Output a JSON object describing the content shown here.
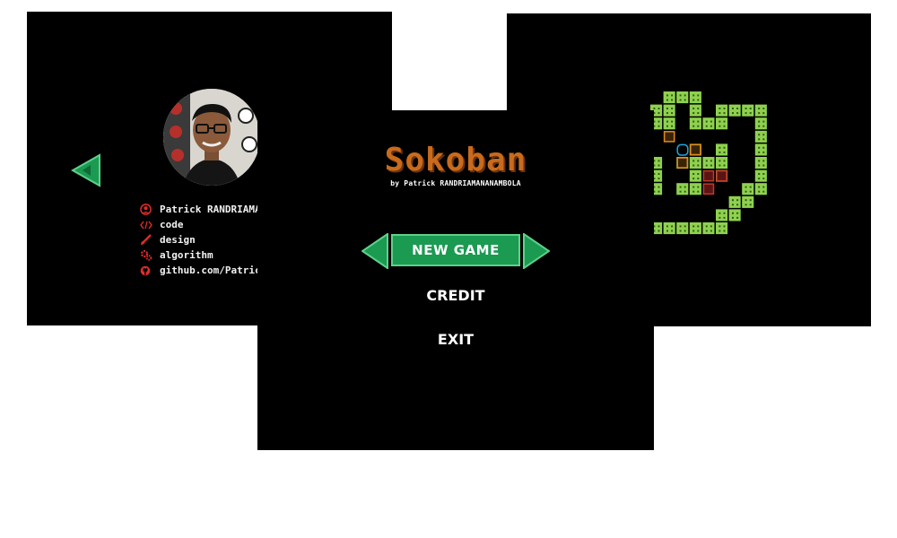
{
  "credit_screen": {
    "back_icon": "left-triangle-icon",
    "author_name": "Patrick RANDRIAMANA",
    "items": [
      {
        "icon": "user-circle-icon",
        "label": "Patrick RANDRIAMANA"
      },
      {
        "icon": "code-icon",
        "label": "code"
      },
      {
        "icon": "brush-icon",
        "label": "design"
      },
      {
        "icon": "gears-icon",
        "label": "algorithm"
      },
      {
        "icon": "github-icon",
        "label": "github.com/Patrickl"
      }
    ],
    "accent_color": "#e02b2b"
  },
  "menu_screen": {
    "title": "Sokoban",
    "subtitle": "by Patrick RANDRIAMANANAMBOLA",
    "new_game_label": "NEW GAME",
    "credit_label": "CREDIT",
    "exit_label": "EXIT",
    "title_color": "#c96a1c",
    "button_color": "#1b9a52"
  },
  "level_screen": {
    "wall_color": "#8fd14f",
    "box_color": "#e08a1a",
    "target_color": "#c0392b",
    "player_color": "#1ea7e0"
  }
}
